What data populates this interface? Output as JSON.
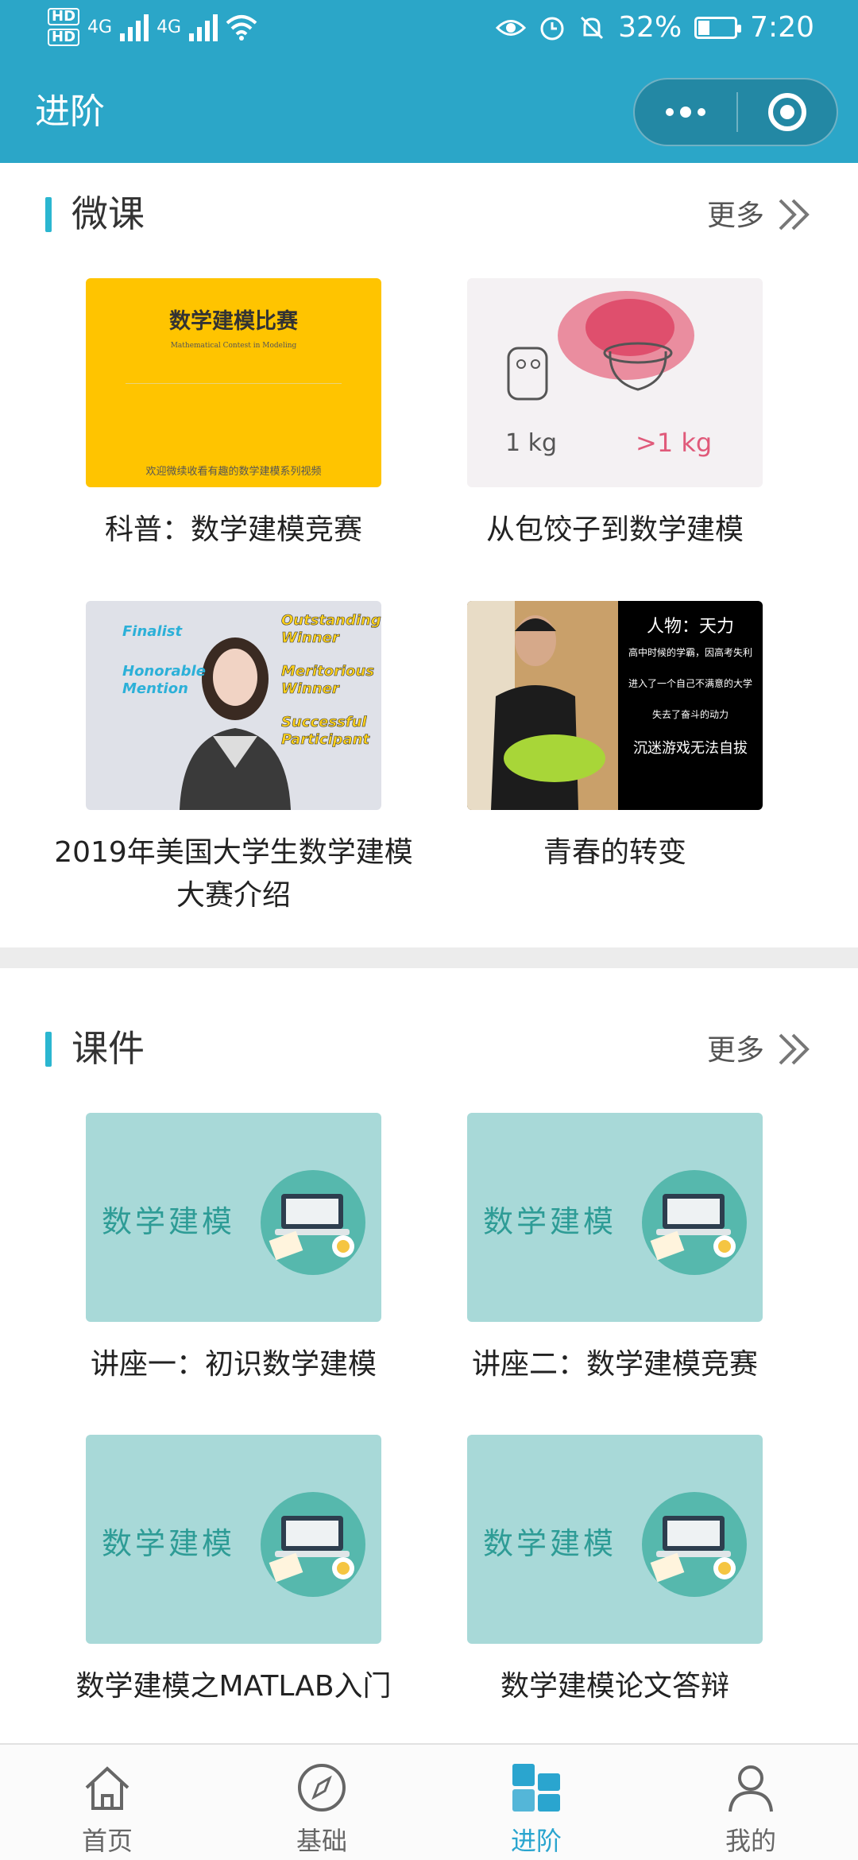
{
  "status_bar": {
    "hd1": "HD",
    "hd2": "HD",
    "net1": "4G",
    "net2": "4G",
    "battery_pct": "32%",
    "time": "7:20"
  },
  "nav": {
    "title": "进阶"
  },
  "sections": {
    "micro": {
      "title": "微课",
      "more": "更多",
      "items": [
        {
          "caption": "科普：数学建模竞赛",
          "thumb_title": "数学建模比赛",
          "thumb_sub": "Mathematical Contest in Modeling",
          "thumb_foot": "欢迎微续收看有趣的数学建模系列视频"
        },
        {
          "caption": "从包饺子到数学建模",
          "left_label": "1 kg",
          "right_label": ">1 kg"
        },
        {
          "caption": "2019年美国大学生数学建模大赛介绍",
          "labels": [
            "Finalist",
            "Honorable Mention",
            "Outstanding Winner",
            "Meritorious Winner",
            "Successful Participant"
          ]
        },
        {
          "caption": "青春的转变",
          "lines": [
            "人物：天力",
            "高中时候的学霸，因高考失利",
            "进入了一个自己不满意的大学",
            "失去了奋斗的动力",
            "沉迷游戏无法自拔"
          ]
        }
      ]
    },
    "courseware": {
      "title": "课件",
      "more": "更多",
      "thumb_text": "数学建模",
      "items": [
        {
          "caption": "讲座一：初识数学建模"
        },
        {
          "caption": "讲座二：数学建模竞赛"
        },
        {
          "caption": "数学建模之MATLAB入门"
        },
        {
          "caption": "数学建模论文答辩"
        }
      ]
    }
  },
  "tabbar": {
    "items": [
      {
        "label": "首页",
        "icon": "home-icon"
      },
      {
        "label": "基础",
        "icon": "compass-icon"
      },
      {
        "label": "进阶",
        "icon": "blocks-icon",
        "active": true
      },
      {
        "label": "我的",
        "icon": "person-icon"
      }
    ]
  },
  "colors": {
    "primary": "#2ba6c8",
    "accent_bar": "#2bb6d0",
    "teal_thumb": "#a8d9d8",
    "yellow_thumb": "#ffc400"
  }
}
